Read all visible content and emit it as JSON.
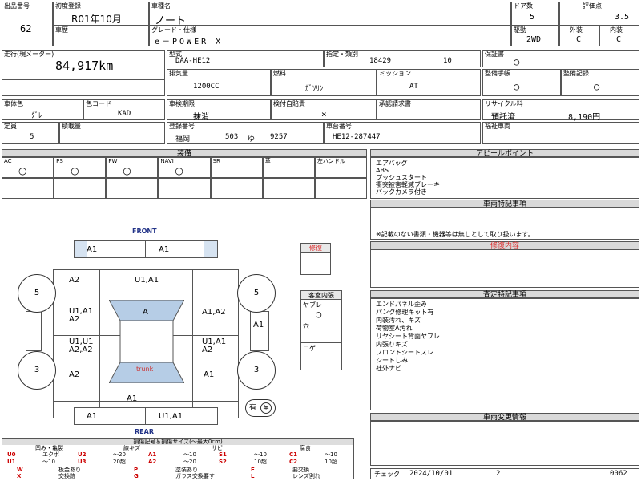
{
  "header": {
    "lot_label": "出品番号",
    "lot_value": "62",
    "first_reg_label": "初度登録",
    "first_reg_value": "R01年10月",
    "model_name_label": "車種名",
    "model_name_value": "ノート",
    "doors_label": "ドア数",
    "doors_value": "5",
    "score_label": "評価点",
    "score_value": "3.5",
    "history_label": "車歴",
    "grade_label": "グレード・仕様",
    "grade_value": "e－POWER X",
    "drive_label": "駆動",
    "drive_value": "2WD",
    "exterior_label": "外装",
    "exterior_value": "C",
    "interior_label": "内装",
    "interior_value": "C"
  },
  "specs": {
    "mileage_label": "走行(現メーター)",
    "mileage_value": "84,917km",
    "type_label": "型式",
    "type_value": "DAA-HE12",
    "designation_label": "指定・類別",
    "designation_value": "18429",
    "class_value": "10",
    "warranty_label": "保証書",
    "warranty_value": "○",
    "displacement_label": "排気量",
    "displacement_value": "1200CC",
    "fuel_label": "燃料",
    "fuel_value": "ｶﾞｿﾘﾝ",
    "mission_label": "ミッション",
    "mission_value": "AT",
    "manual_label": "整備手帳",
    "manual_value": "○",
    "record_label": "整備記録",
    "record_value": "○",
    "body_color_label": "車体色",
    "body_color_value": "ｸﾞﾚｰ",
    "color_code_label": "色コード",
    "color_code_value": "KAD",
    "inspection_label": "車検期限",
    "inspection_value": "抹消",
    "liability_label": "検付自賠責",
    "liability_value": "×",
    "approval_label": "承認請求書",
    "recycle_label": "リサイクル料",
    "recycle_status": "預託済",
    "recycle_value": "8,190円",
    "capacity_label": "定員",
    "capacity_value": "5",
    "load_label": "積載量",
    "plate_label": "登録番号",
    "plate_region": "福岡",
    "plate_class": "503",
    "plate_kana": "ゆ",
    "plate_number": "9257",
    "chassis_label": "車台番号",
    "chassis_value": "HE12-287447",
    "welfare_label": "福祉車両"
  },
  "equipment": {
    "title": "装備",
    "cols": [
      {
        "label": "AC",
        "value": "○"
      },
      {
        "label": "PS",
        "value": "○"
      },
      {
        "label": "PW",
        "value": "○"
      },
      {
        "label": "NAVI",
        "value": "○"
      },
      {
        "label": "SR",
        "value": ""
      },
      {
        "label": "革",
        "value": ""
      },
      {
        "label": "左ハンドル",
        "value": ""
      }
    ]
  },
  "appeal": {
    "title": "アピールポイント",
    "lines": [
      "エアバッグ",
      "ABS",
      "プッシュスタート",
      "衝突被害軽減ブレーキ",
      "バックカメラ付き"
    ]
  },
  "special": {
    "title": "車両特記事項",
    "note": "※記載のない書類・機器等は無しとして取り扱います。"
  },
  "repair": {
    "title": "修復内容",
    "box_label": "修復"
  },
  "inspection_notes": {
    "title": "査定特記事項",
    "lines": [
      "エンドパネル歪み",
      "パンク修理キット有",
      "内装汚れ、キズ",
      "荷物室A汚れ",
      "リヤシート背面ヤブレ",
      "内張りキズ",
      "フロントシートスレ",
      "シートしみ",
      "社外ナビ"
    ]
  },
  "change": {
    "title": "車両変更情報"
  },
  "cabin": {
    "title": "客室内張",
    "tear_label": "ヤブレ",
    "tear_value": "○",
    "hole_label": "穴",
    "burn_label": "コゲ"
  },
  "diagram": {
    "front_label": "FRONT",
    "rear_label": "REAR",
    "trunk_label": "trunk",
    "cells": {
      "top_left": "A1",
      "top_right": "A1",
      "hood_left": "A2",
      "hood_center": "U1,A1",
      "front_door_left": "U1,A1\nA2",
      "roof": "A",
      "front_door_right": "A1,A2",
      "right_side": "A1",
      "rear_door_left": "U1,U1\nA2,A2",
      "rear_door_right": "U1,A1\nA2",
      "rear_left": "A2",
      "rear_right": "A1",
      "rear_center": "A1",
      "bottom_left": "A1",
      "bottom_right": "U1,A1"
    },
    "wheels": {
      "fl": "5",
      "fr": "5",
      "rl": "3",
      "rr": "3"
    },
    "spare_label": "有",
    "spare_mark": "無"
  },
  "legend": {
    "title": "損傷記号＆損傷サイズ(〜最大0cm)",
    "heads": [
      "凹み・亀裂",
      "線キズ",
      "サビ",
      "腐食"
    ],
    "rows": [
      [
        "U0",
        "エクボ",
        "U2",
        "〜20",
        "A1",
        "〜10",
        "S1",
        "〜10",
        "C1",
        "〜10"
      ],
      [
        "U1",
        "〜10",
        "U3",
        "20超",
        "A2",
        "〜20",
        "S2",
        "10超",
        "C2",
        "10超"
      ]
    ],
    "rows2": [
      [
        "W",
        "板金あり",
        "P",
        "塗装あり",
        "E",
        "要交換"
      ],
      [
        "X",
        "交換跡",
        "G",
        "ガラス交換要す",
        "L",
        "レンズ割れ"
      ]
    ]
  },
  "check": {
    "label": "チェック",
    "date": "2024/10/01",
    "number": "2",
    "code": "0062"
  }
}
